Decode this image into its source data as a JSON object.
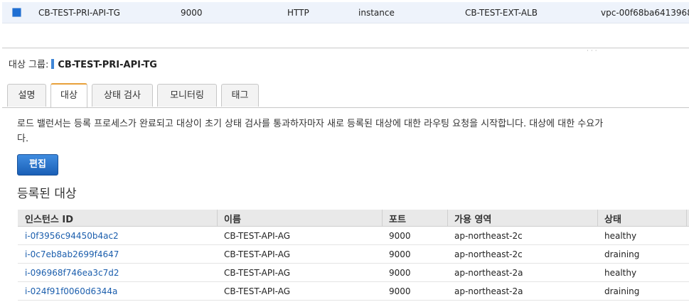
{
  "target_group_row": {
    "name": "CB-TEST-PRI-API-TG",
    "port": "9000",
    "protocol": "HTTP",
    "target_type": "instance",
    "load_balancer": "CB-TEST-EXT-ALB",
    "vpc": "vpc-00f68ba6413968"
  },
  "detail": {
    "label": "대상 그룹:",
    "name": "CB-TEST-PRI-API-TG"
  },
  "tabs": [
    {
      "label": "설명"
    },
    {
      "label": "대상"
    },
    {
      "label": "상태 검사"
    },
    {
      "label": "모니터링"
    },
    {
      "label": "태그"
    }
  ],
  "active_tab": "대상",
  "description_line1": "로드 밸런서는 등록 프로세스가 완료되고 대상이 초기 상태 검사를 통과하자마자 새로 등록된 대상에 대한 라우팅 요청을 시작합니다. 대상에 대한 수요가",
  "description_line2": "다.",
  "edit_button": "편집",
  "registered_targets_title": "등록된 대상",
  "table": {
    "headers": {
      "instance_id": "인스턴스 ID",
      "name": "이름",
      "port": "포트",
      "az": "가용 영역",
      "status": "상태"
    },
    "rows": [
      {
        "instance_id": "i-0f3956c94450b4ac2",
        "name": "CB-TEST-API-AG",
        "port": "9000",
        "az": "ap-northeast-2c",
        "status": "healthy"
      },
      {
        "instance_id": "i-0c7eb8ab2699f4647",
        "name": "CB-TEST-API-AG",
        "port": "9000",
        "az": "ap-northeast-2c",
        "status": "draining"
      },
      {
        "instance_id": "i-096968f746ea3c7d2",
        "name": "CB-TEST-API-AG",
        "port": "9000",
        "az": "ap-northeast-2a",
        "status": "healthy"
      },
      {
        "instance_id": "i-024f91f0060d6344a",
        "name": "CB-TEST-API-AG",
        "port": "9000",
        "az": "ap-northeast-2a",
        "status": "draining"
      }
    ]
  },
  "colors": {
    "accent_blue": "#1a5fb6",
    "link": "#1b5ead",
    "active_tab_marker": "#e8a13a"
  }
}
